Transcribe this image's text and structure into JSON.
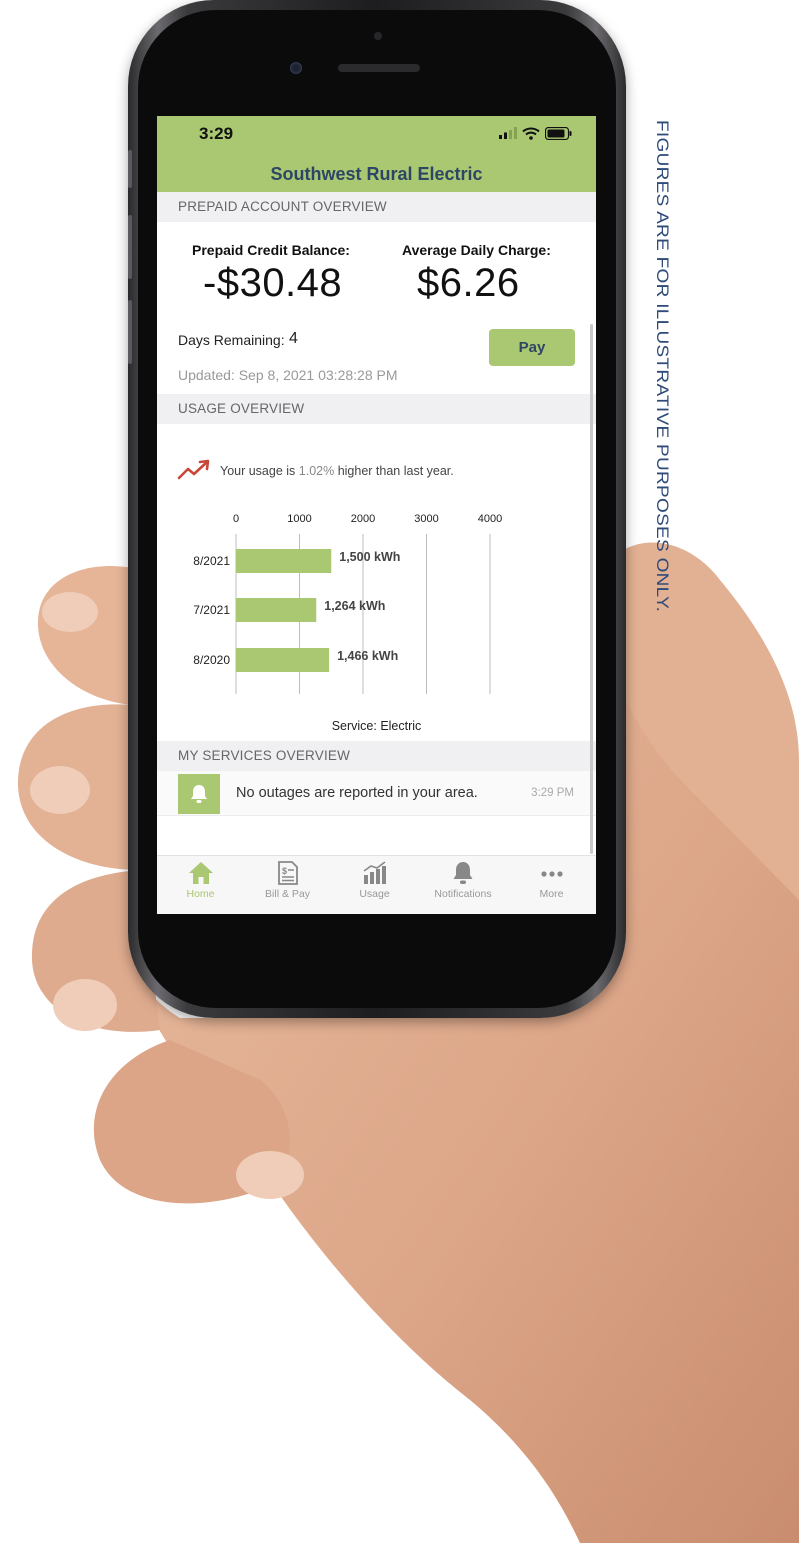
{
  "status_bar": {
    "time": "3:29"
  },
  "header": {
    "title": "Southwest Rural Electric"
  },
  "prepaid": {
    "section_title": "PREPAID ACCOUNT OVERVIEW",
    "balance_label": "Prepaid Credit Balance:",
    "balance_value": "-$30.48",
    "avg_label": "Average Daily Charge:",
    "avg_value": "$6.26",
    "days_label": "Days Remaining:",
    "days_value": "4",
    "pay_label": "Pay",
    "updated": "Updated: Sep 8, 2021 03:28:28 PM"
  },
  "usage": {
    "section_title": "USAGE OVERVIEW",
    "text_before": "Your usage is ",
    "percent": "1.02%",
    "text_after": " higher than last year.",
    "service_label": "Service: Electric"
  },
  "chart_data": {
    "type": "bar",
    "orientation": "horizontal",
    "categories": [
      "8/2021",
      "7/2021",
      "8/2020"
    ],
    "values": [
      1500,
      1264,
      1466
    ],
    "value_labels": [
      "1,500 kWh",
      "1,264 kWh",
      "1,466 kWh"
    ],
    "x_ticks": [
      0,
      1000,
      2000,
      3000,
      4000
    ],
    "xlim": [
      0,
      4000
    ],
    "grid": true,
    "bar_color": "#a9c871"
  },
  "services": {
    "section_title": "MY SERVICES OVERVIEW",
    "alert_text": "No outages are reported in your area.",
    "alert_time": "3:29 PM"
  },
  "tabs": [
    {
      "label": "Home",
      "icon": "home-icon",
      "active": true
    },
    {
      "label": "Bill & Pay",
      "icon": "bill-icon",
      "active": false
    },
    {
      "label": "Usage",
      "icon": "usage-chart-icon",
      "active": false
    },
    {
      "label": "Notifications",
      "icon": "bell-icon",
      "active": false
    },
    {
      "label": "More",
      "icon": "more-icon",
      "active": false
    }
  ],
  "caption": "FIGURES ARE FOR ILLUSTRATIVE PURPOSES ONLY.",
  "colors": {
    "accent": "#a9c871",
    "title": "#2e4666",
    "caption": "#2e4b7a"
  }
}
